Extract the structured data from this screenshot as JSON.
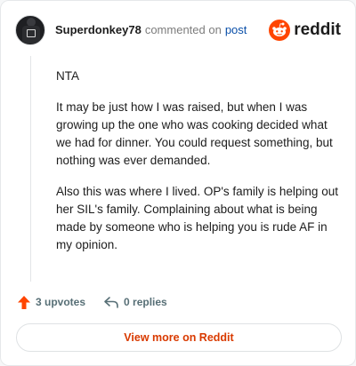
{
  "header": {
    "username": "Superdonkey78",
    "commented_text": "commented on",
    "post_link": "post",
    "brand_word": "reddit"
  },
  "comment": {
    "paragraphs": [
      "NTA",
      "It may be just how I was raised, but when I was growing up the one who was cooking decided what we had for dinner. You could request something, but nothing was ever demanded.",
      "Also this was where I lived. OP's family is helping out her SIL's family. Complaining about what is being made by someone who is helping you is rude AF in my opinion."
    ]
  },
  "actions": {
    "upvotes": "3 upvotes",
    "replies": "0 replies"
  },
  "footer": {
    "view_more": "View more on Reddit"
  },
  "colors": {
    "brand_orange": "#ff4500",
    "link_blue": "#0a4fa8",
    "upvote_orange": "#ff4500",
    "button_text": "#d93a00"
  },
  "icons": {
    "brand": "reddit-snoo-icon",
    "upvote": "upvote-arrow-icon",
    "reply": "reply-arrow-icon"
  }
}
